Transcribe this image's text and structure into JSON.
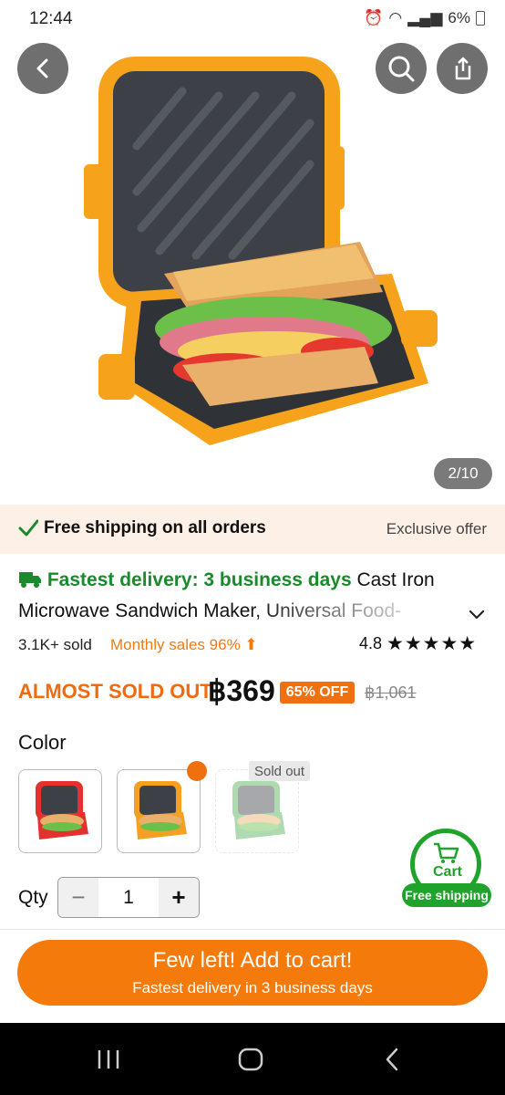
{
  "status_bar": {
    "time": "12:44",
    "battery": "6%"
  },
  "gallery": {
    "counter": "2/10"
  },
  "shipping_banner": {
    "label": "Free shipping on all orders",
    "offer": "Exclusive offer"
  },
  "product": {
    "delivery_label": "Fastest delivery: 3 business days",
    "title_line1": "Cast Iron",
    "title_line2": "Microwave Sandwich Maker, Universal Food-",
    "sold": "3.1K+ sold",
    "monthly_sales": "Monthly sales 96%",
    "rating": "4.8",
    "stars": "★★★★★",
    "rating_value": 4.8,
    "scarcity": "ALMOST SOLD OUT",
    "price": "฿369",
    "discount": "65% OFF",
    "original_price": "฿1,061"
  },
  "color": {
    "label": "Color",
    "options": [
      {
        "name": "red",
        "color": "#e53030"
      },
      {
        "name": "orange",
        "color": "#f5a020"
      },
      {
        "name": "green",
        "color": "#4caf50",
        "status": "Sold out"
      }
    ]
  },
  "quantity": {
    "label": "Qty",
    "value": "1",
    "minus": "−",
    "plus": "+"
  },
  "floating_cart": {
    "label": "Cart",
    "badge": "Free shipping"
  },
  "cta": {
    "title": "Few left! Add to cart!",
    "subtitle": "Fastest delivery in 3 business days"
  },
  "colors": {
    "accent": "#f57a0c",
    "green": "#1a8a2c",
    "band": "#fdf0e6"
  }
}
